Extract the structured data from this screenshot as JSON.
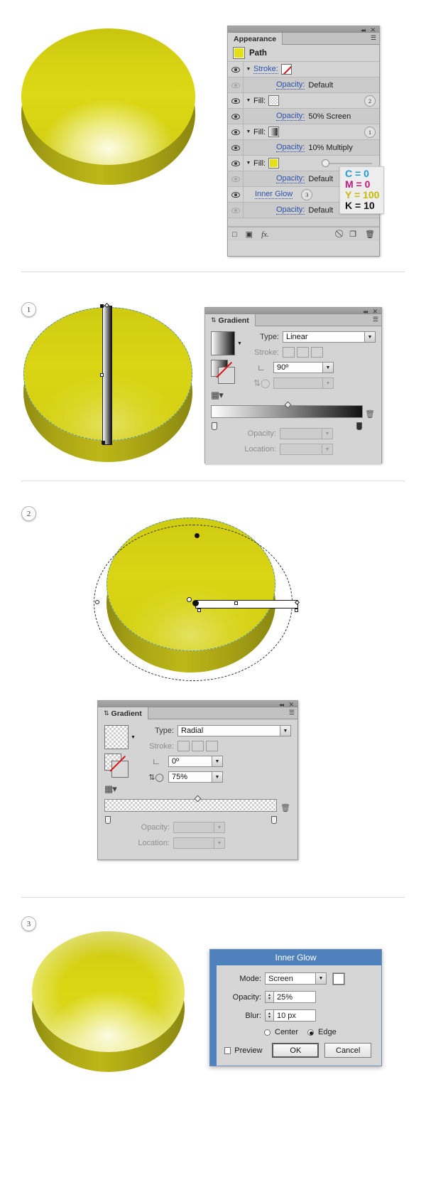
{
  "appearance_panel": {
    "tab_label": "Appearance",
    "rows": [
      {
        "type": "header",
        "label": "Path",
        "swatch": "yellow"
      },
      {
        "type": "item",
        "label": "Stroke:",
        "swatch": "none",
        "badge": "",
        "eye": "on"
      },
      {
        "type": "opacity",
        "label": "Opacity:",
        "value": "Default",
        "eye": "dim"
      },
      {
        "type": "item",
        "label": "Fill:",
        "swatch": "checker",
        "badge": "2",
        "eye": "on"
      },
      {
        "type": "opacity",
        "label": "Opacity:",
        "value": "50% Screen",
        "eye": "on"
      },
      {
        "type": "item",
        "label": "Fill:",
        "swatch": "gradient",
        "badge": "1",
        "eye": "on"
      },
      {
        "type": "opacity",
        "label": "Opacity:",
        "value": "10% Multiply",
        "eye": "on"
      },
      {
        "type": "item",
        "label": "Fill:",
        "swatch": "yellow",
        "badge": "",
        "eye": "on"
      },
      {
        "type": "opacity",
        "label": "Opacity:",
        "value": "Default",
        "eye": "dim"
      },
      {
        "type": "effect",
        "label": "Inner Glow",
        "badge": "3",
        "eye": "on"
      },
      {
        "type": "opacity",
        "label": "Opacity:",
        "value": "Default",
        "eye": "dim"
      }
    ],
    "footer_icons": [
      "add-new-stroke-icon",
      "add-new-fill-icon",
      "add-new-effect-icon",
      "clear-appearance-icon",
      "duplicate-item-icon",
      "delete-item-icon"
    ]
  },
  "cmyk_callout": {
    "c": "C = 0",
    "m": "M = 0",
    "y": "Y = 100",
    "k": "K = 10"
  },
  "steps": {
    "one": "1",
    "two": "2",
    "three": "3"
  },
  "gradient_panel_linear": {
    "tab_label": "Gradient",
    "type_label": "Type:",
    "type_value": "Linear",
    "stroke_label": "Stroke:",
    "angle_label": "angle-icon",
    "angle_value": "90º",
    "aspect_label": "aspect-ratio-icon",
    "aspect_value": "",
    "opacity_label": "Opacity:",
    "opacity_value": "",
    "location_label": "Location:",
    "location_value": ""
  },
  "gradient_panel_radial": {
    "tab_label": "Gradient",
    "type_label": "Type:",
    "type_value": "Radial",
    "stroke_label": "Stroke:",
    "angle_value": "0º",
    "aspect_value": "75%",
    "opacity_label": "Opacity:",
    "opacity_value": "",
    "location_label": "Location:",
    "location_value": ""
  },
  "inner_glow_dialog": {
    "title": "Inner Glow",
    "mode_label": "Mode:",
    "mode_value": "Screen",
    "opacity_label": "Opacity:",
    "opacity_value": "25%",
    "blur_label": "Blur:",
    "blur_value": "10 px",
    "center_label": "Center",
    "edge_label": "Edge",
    "preview_label": "Preview",
    "ok_label": "OK",
    "cancel_label": "Cancel"
  }
}
